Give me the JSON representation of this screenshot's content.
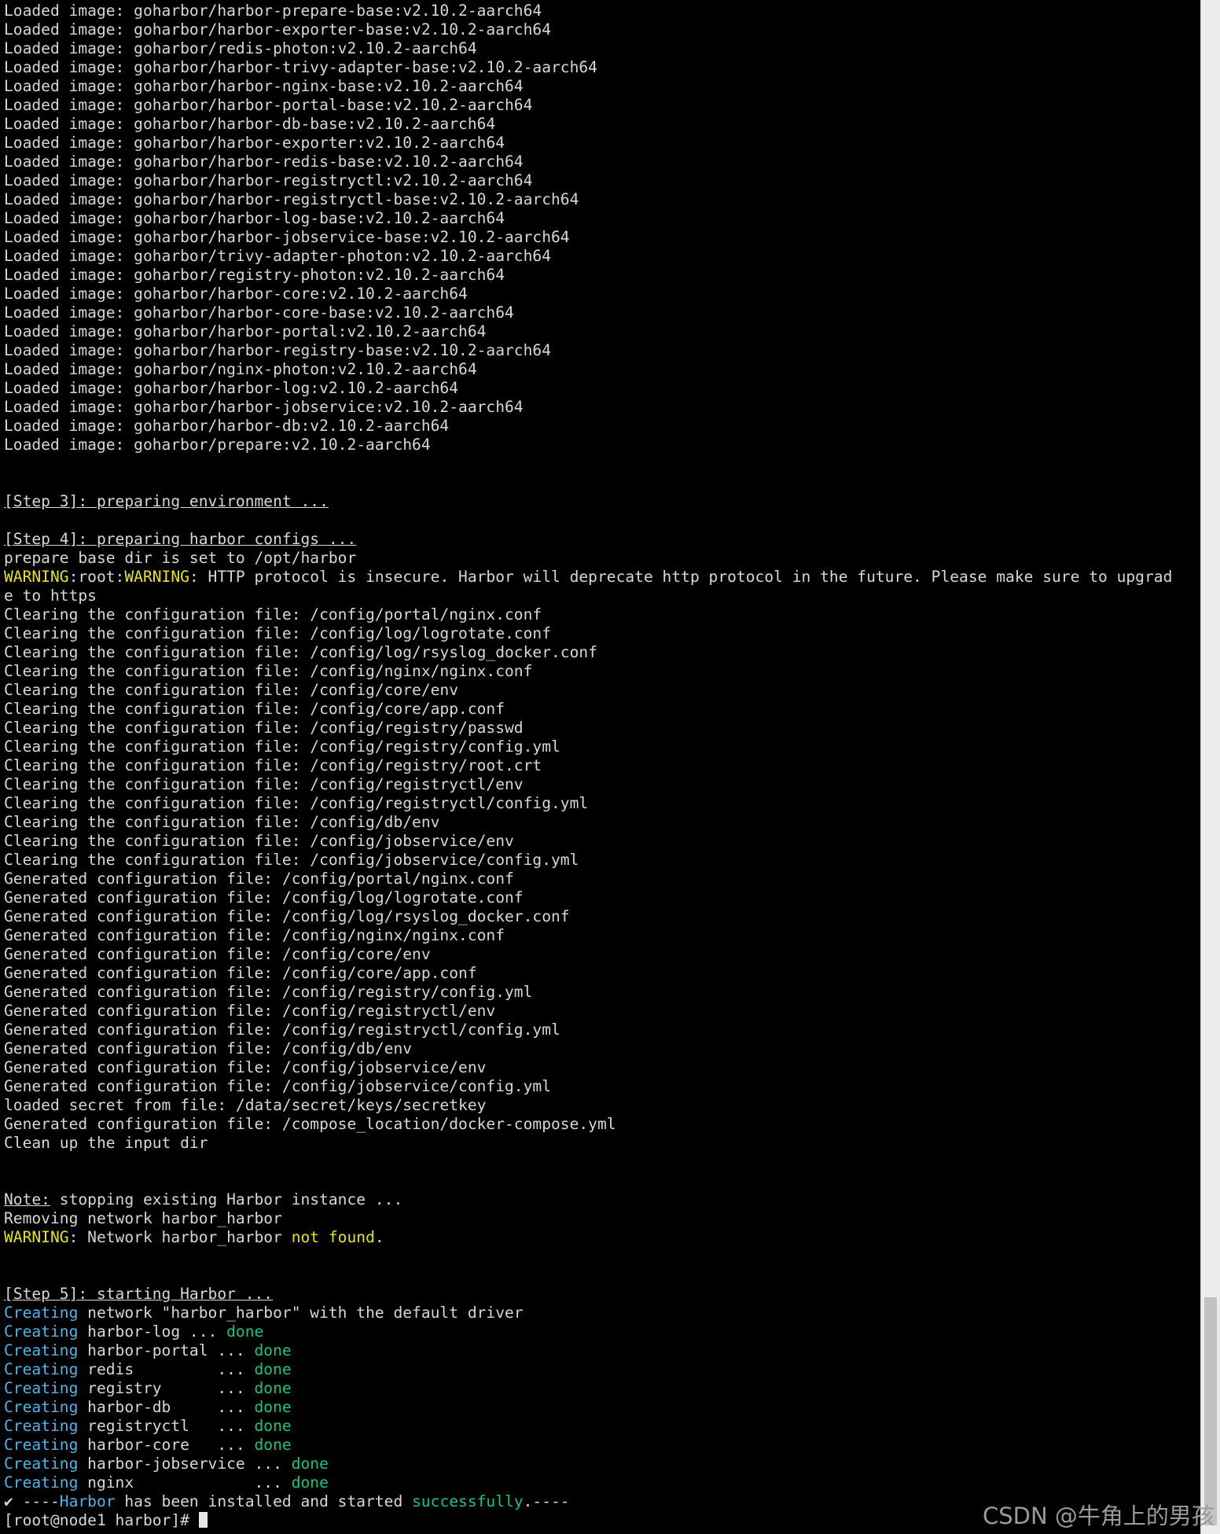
{
  "terminal": {
    "lines": [
      "Loaded image: goharbor/harbor-prepare-base:v2.10.2-aarch64",
      "Loaded image: goharbor/harbor-exporter-base:v2.10.2-aarch64",
      "Loaded image: goharbor/redis-photon:v2.10.2-aarch64",
      "Loaded image: goharbor/harbor-trivy-adapter-base:v2.10.2-aarch64",
      "Loaded image: goharbor/harbor-nginx-base:v2.10.2-aarch64",
      "Loaded image: goharbor/harbor-portal-base:v2.10.2-aarch64",
      "Loaded image: goharbor/harbor-db-base:v2.10.2-aarch64",
      "Loaded image: goharbor/harbor-exporter:v2.10.2-aarch64",
      "Loaded image: goharbor/harbor-redis-base:v2.10.2-aarch64",
      "Loaded image: goharbor/harbor-registryctl:v2.10.2-aarch64",
      "Loaded image: goharbor/harbor-registryctl-base:v2.10.2-aarch64",
      "Loaded image: goharbor/harbor-log-base:v2.10.2-aarch64",
      "Loaded image: goharbor/harbor-jobservice-base:v2.10.2-aarch64",
      "Loaded image: goharbor/trivy-adapter-photon:v2.10.2-aarch64",
      "Loaded image: goharbor/registry-photon:v2.10.2-aarch64",
      "Loaded image: goharbor/harbor-core:v2.10.2-aarch64",
      "Loaded image: goharbor/harbor-core-base:v2.10.2-aarch64",
      "Loaded image: goharbor/harbor-portal:v2.10.2-aarch64",
      "Loaded image: goharbor/harbor-registry-base:v2.10.2-aarch64",
      "Loaded image: goharbor/nginx-photon:v2.10.2-aarch64",
      "Loaded image: goharbor/harbor-log:v2.10.2-aarch64",
      "Loaded image: goharbor/harbor-jobservice:v2.10.2-aarch64",
      "Loaded image: goharbor/harbor-db:v2.10.2-aarch64",
      "Loaded image: goharbor/prepare:v2.10.2-aarch64",
      "",
      "",
      {
        "t": "[Step 3]: preparing environment ...",
        "cls": "u"
      },
      "",
      {
        "t": "[Step 4]: preparing harbor configs ...",
        "cls": "u"
      },
      "prepare base dir is set to /opt/harbor",
      [
        {
          "t": "WARNING",
          "cls": "c-yellow"
        },
        {
          "t": ":root:"
        },
        {
          "t": "WARNING",
          "cls": "c-yellow"
        },
        {
          "t": ": HTTP protocol is insecure. Harbor will deprecate http protocol in the future. Please make sure to upgrad"
        }
      ],
      "e to https",
      "Clearing the configuration file: /config/portal/nginx.conf",
      "Clearing the configuration file: /config/log/logrotate.conf",
      "Clearing the configuration file: /config/log/rsyslog_docker.conf",
      "Clearing the configuration file: /config/nginx/nginx.conf",
      "Clearing the configuration file: /config/core/env",
      "Clearing the configuration file: /config/core/app.conf",
      "Clearing the configuration file: /config/registry/passwd",
      "Clearing the configuration file: /config/registry/config.yml",
      "Clearing the configuration file: /config/registry/root.crt",
      "Clearing the configuration file: /config/registryctl/env",
      "Clearing the configuration file: /config/registryctl/config.yml",
      "Clearing the configuration file: /config/db/env",
      "Clearing the configuration file: /config/jobservice/env",
      "Clearing the configuration file: /config/jobservice/config.yml",
      "Generated configuration file: /config/portal/nginx.conf",
      "Generated configuration file: /config/log/logrotate.conf",
      "Generated configuration file: /config/log/rsyslog_docker.conf",
      "Generated configuration file: /config/nginx/nginx.conf",
      "Generated configuration file: /config/core/env",
      "Generated configuration file: /config/core/app.conf",
      "Generated configuration file: /config/registry/config.yml",
      "Generated configuration file: /config/registryctl/env",
      "Generated configuration file: /config/registryctl/config.yml",
      "Generated configuration file: /config/db/env",
      "Generated configuration file: /config/jobservice/env",
      "Generated configuration file: /config/jobservice/config.yml",
      "loaded secret from file: /data/secret/keys/secretkey",
      "Generated configuration file: /compose_location/docker-compose.yml",
      "Clean up the input dir",
      "",
      "",
      [
        {
          "t": "Note:",
          "cls": "u"
        },
        {
          "t": " stopping existing Harbor instance ..."
        }
      ],
      "Removing network harbor_harbor",
      [
        {
          "t": "WARNING",
          "cls": "c-yellow"
        },
        {
          "t": ": Network harbor_harbor "
        },
        {
          "t": "not found",
          "cls": "c-yellow"
        },
        {
          "t": "."
        }
      ],
      "",
      "",
      {
        "t": "[Step 5]: starting Harbor ...",
        "cls": "u"
      },
      [
        {
          "t": "Creating",
          "cls": "c-cyan"
        },
        {
          "t": " network \"harbor_harbor\" with the default driver"
        }
      ],
      [
        {
          "t": "Creating",
          "cls": "c-cyan"
        },
        {
          "t": " harbor-log ... "
        },
        {
          "t": "done",
          "cls": "c-green"
        }
      ],
      [
        {
          "t": "Creating",
          "cls": "c-cyan"
        },
        {
          "t": " harbor-portal ... "
        },
        {
          "t": "done",
          "cls": "c-green"
        }
      ],
      [
        {
          "t": "Creating",
          "cls": "c-cyan"
        },
        {
          "t": " redis         ... "
        },
        {
          "t": "done",
          "cls": "c-green"
        }
      ],
      [
        {
          "t": "Creating",
          "cls": "c-cyan"
        },
        {
          "t": " registry      ... "
        },
        {
          "t": "done",
          "cls": "c-green"
        }
      ],
      [
        {
          "t": "Creating",
          "cls": "c-cyan"
        },
        {
          "t": " harbor-db     ... "
        },
        {
          "t": "done",
          "cls": "c-green"
        }
      ],
      [
        {
          "t": "Creating",
          "cls": "c-cyan"
        },
        {
          "t": " registryctl   ... "
        },
        {
          "t": "done",
          "cls": "c-green"
        }
      ],
      [
        {
          "t": "Creating",
          "cls": "c-cyan"
        },
        {
          "t": " harbor-core   ... "
        },
        {
          "t": "done",
          "cls": "c-green"
        }
      ],
      [
        {
          "t": "Creating",
          "cls": "c-cyan"
        },
        {
          "t": " harbor-jobservice ... "
        },
        {
          "t": "done",
          "cls": "c-green"
        }
      ],
      [
        {
          "t": "Creating",
          "cls": "c-cyan"
        },
        {
          "t": " nginx             ... "
        },
        {
          "t": "done",
          "cls": "c-green"
        }
      ],
      [
        {
          "t": "✔ ----"
        },
        {
          "t": "Harbor",
          "cls": "c-cyan"
        },
        {
          "t": " has been installed and started "
        },
        {
          "t": "successfully",
          "cls": "c-green"
        },
        {
          "t": ".----"
        }
      ]
    ],
    "prompt": "[root@node1 harbor]# "
  },
  "watermark": "CSDN @牛角上的男孩",
  "colors": {
    "background": "#000000",
    "text": "#d7d7d7",
    "warning_yellow": "#e5e510",
    "info_cyan": "#4fb4ea",
    "success_green": "#13c77f"
  }
}
